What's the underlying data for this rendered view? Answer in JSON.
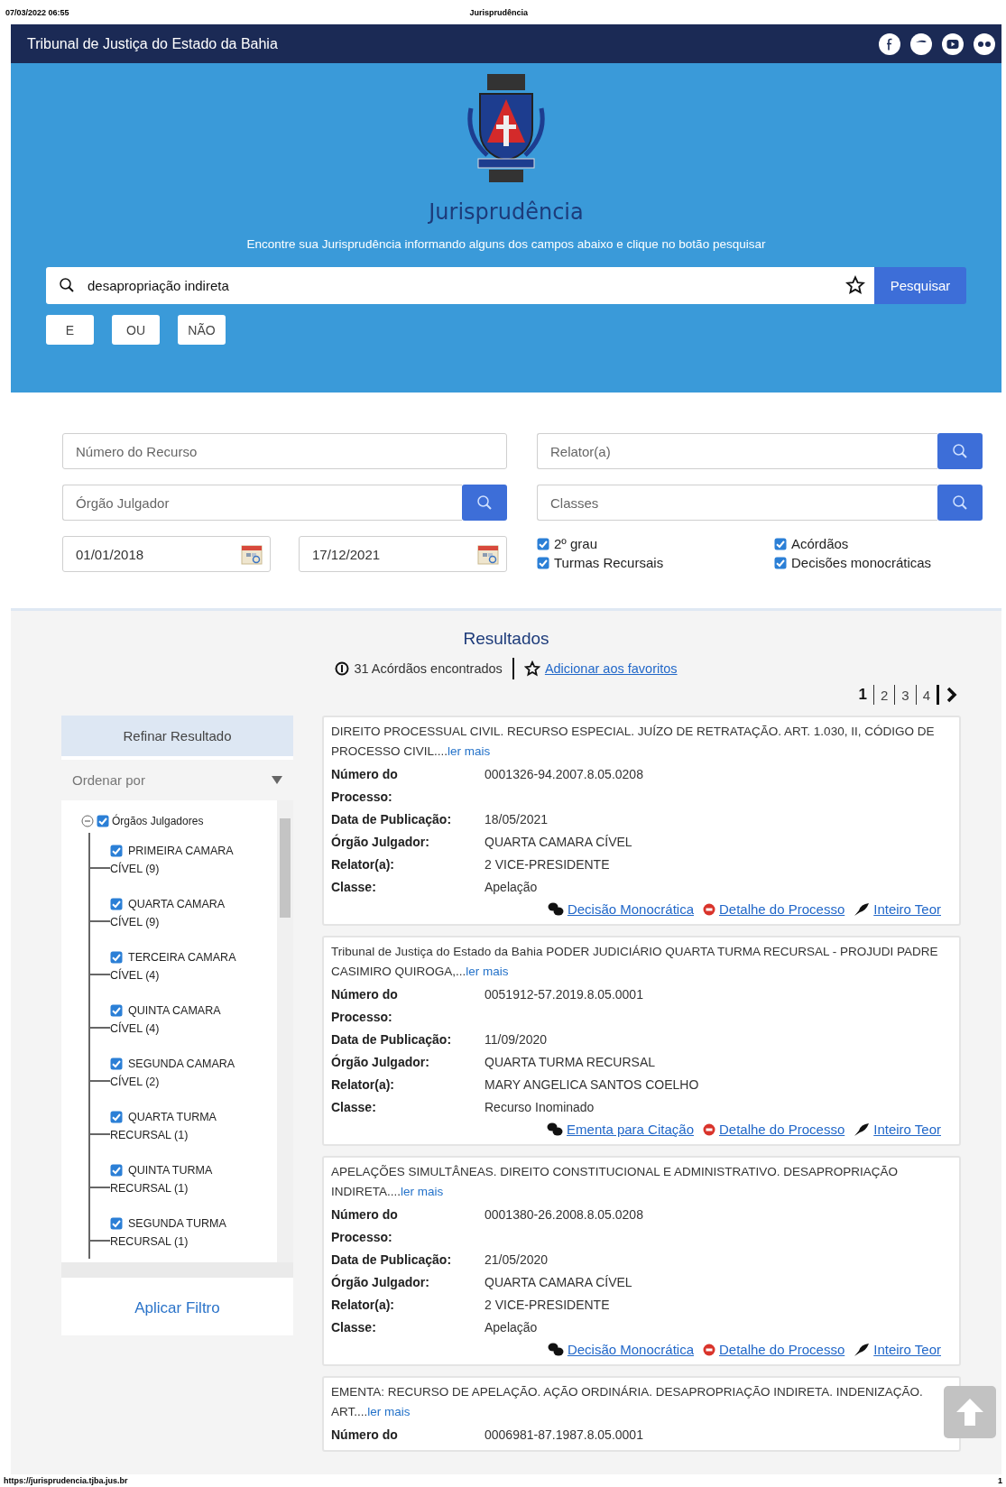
{
  "print_header": {
    "date": "07/03/2022 06:55",
    "title": "Jurisprudência"
  },
  "top_bar": {
    "title": "Tribunal de Justiça do Estado da Bahia"
  },
  "hero": {
    "title": "Jurisprudência",
    "subtitle": "Encontre sua Jurisprudência informando alguns dos campos abaixo e clique no botão pesquisar",
    "search": {
      "value": "desapropriação indireta",
      "button": "Pesquisar"
    },
    "operators": [
      "E",
      "OU",
      "NÃO"
    ]
  },
  "filters": {
    "fields": [
      {
        "placeholder": "Número do Recurso",
        "kind": "text"
      },
      {
        "placeholder": "Relator(a)",
        "kind": "lookup"
      },
      {
        "placeholder": "Órgão Julgador",
        "kind": "lookup"
      },
      {
        "placeholder": "Classes",
        "kind": "lookup"
      }
    ],
    "dates": [
      {
        "value": "01/01/2018"
      },
      {
        "value": "17/12/2021"
      }
    ],
    "checkboxes": [
      {
        "label": "2º grau",
        "checked": true
      },
      {
        "label": "Acórdãos",
        "checked": true
      },
      {
        "label": "Turmas Recursais",
        "checked": true
      },
      {
        "label": "Decisões monocráticas",
        "checked": true
      }
    ]
  },
  "results": {
    "title": "Resultados",
    "count": "31 Acórdãos encontrados",
    "favorites_link": "Adicionar aos favoritos",
    "pages": [
      {
        "label": "1",
        "selected": true
      },
      {
        "label": "2",
        "selected": false
      },
      {
        "label": "3",
        "selected": false
      },
      {
        "label": "4",
        "selected": false
      }
    ],
    "sidebar": {
      "title": "Refinar Resultado",
      "sort": {
        "placeholder": "Ordenar por"
      },
      "tree": {
        "label": "Órgãos Julgadores",
        "checked": true,
        "expanded": true,
        "children": [
          {
            "label": "PRIMEIRA CAMARA CÍVEL (9)",
            "checked": true
          },
          {
            "label": "QUARTA CAMARA CÍVEL (9)",
            "checked": true
          },
          {
            "label": "TERCEIRA CAMARA CÍVEL (4)",
            "checked": true
          },
          {
            "label": "QUINTA CAMARA CÍVEL (4)",
            "checked": true
          },
          {
            "label": "SEGUNDA CAMARA CÍVEL (2)",
            "checked": true
          },
          {
            "label": "QUARTA TURMA RECURSAL (1)",
            "checked": true
          },
          {
            "label": "QUINTA TURMA RECURSAL (1)",
            "checked": true
          },
          {
            "label": "SEGUNDA TURMA RECURSAL (1)",
            "checked": true
          }
        ]
      },
      "apply": "Aplicar Filtro"
    },
    "cards": [
      {
        "summary": "DIREITO PROCESSUAL CIVIL. RECURSO ESPECIAL. JUÍZO DE RETRATAÇÃO. ART. 1.030, II, CÓDIGO DE PROCESSO CIVIL....",
        "more": "ler mais",
        "fields": [
          {
            "label": "Número do Processo:",
            "value": "0001326-94.2007.8.05.0208"
          },
          {
            "label": "Data de Publicação:",
            "value": "18/05/2021"
          },
          {
            "label": "Órgão Julgador:",
            "value": "QUARTA CAMARA CÍVEL"
          },
          {
            "label": "Relator(a):",
            "value": "2 VICE-PRESIDENTE"
          },
          {
            "label": "Classe:",
            "value": "Apelação"
          }
        ],
        "links": [
          {
            "label": "Decisão Monocrática",
            "kind": "summary"
          },
          {
            "label": "Detalhe do Processo",
            "kind": "details"
          },
          {
            "label": "Inteiro Teor",
            "kind": "fulltext"
          }
        ]
      },
      {
        "summary": "Tribunal de Justiça do Estado da Bahia PODER JUDICIÁRIO QUARTA TURMA RECURSAL - PROJUDI PADRE CASIMIRO QUIROGA,...",
        "more": "ler mais",
        "fields": [
          {
            "label": "Número do Processo:",
            "value": "0051912-57.2019.8.05.0001"
          },
          {
            "label": "Data de Publicação:",
            "value": "11/09/2020"
          },
          {
            "label": "Órgão Julgador:",
            "value": "QUARTA TURMA RECURSAL"
          },
          {
            "label": "Relator(a):",
            "value": "MARY ANGELICA SANTOS COELHO"
          },
          {
            "label": "Classe:",
            "value": "Recurso Inominado"
          }
        ],
        "links": [
          {
            "label": "Ementa para Citação",
            "kind": "summary"
          },
          {
            "label": "Detalhe do Processo",
            "kind": "details"
          },
          {
            "label": "Inteiro Teor",
            "kind": "fulltext"
          }
        ]
      },
      {
        "summary": "APELAÇÕES SIMULTÂNEAS. DIREITO CONSTITUCIONAL E ADMINISTRATIVO. DESAPROPRIAÇÃO INDIRETA....",
        "more": "ler mais",
        "fields": [
          {
            "label": "Número do Processo:",
            "value": "0001380-26.2008.8.05.0208"
          },
          {
            "label": "Data de Publicação:",
            "value": "21/05/2020"
          },
          {
            "label": "Órgão Julgador:",
            "value": "QUARTA CAMARA CÍVEL"
          },
          {
            "label": "Relator(a):",
            "value": "2 VICE-PRESIDENTE"
          },
          {
            "label": "Classe:",
            "value": "Apelação"
          }
        ],
        "links": [
          {
            "label": "Decisão Monocrática",
            "kind": "summary"
          },
          {
            "label": "Detalhe do Processo",
            "kind": "details"
          },
          {
            "label": "Inteiro Teor",
            "kind": "fulltext"
          }
        ]
      },
      {
        "summary": "EMENTA: RECURSO DE APELAÇÃO. AÇÃO ORDINÁRIA. DESAPROPRIAÇÃO INDIRETA. INDENIZAÇÃO. ART....",
        "more": "ler mais",
        "fields": [
          {
            "label": "Número do",
            "value": "0006981-87.1987.8.05.0001"
          }
        ]
      }
    ]
  },
  "footer": {
    "url": "https://jurisprudencia.tjba.jus.br",
    "page": "1"
  }
}
